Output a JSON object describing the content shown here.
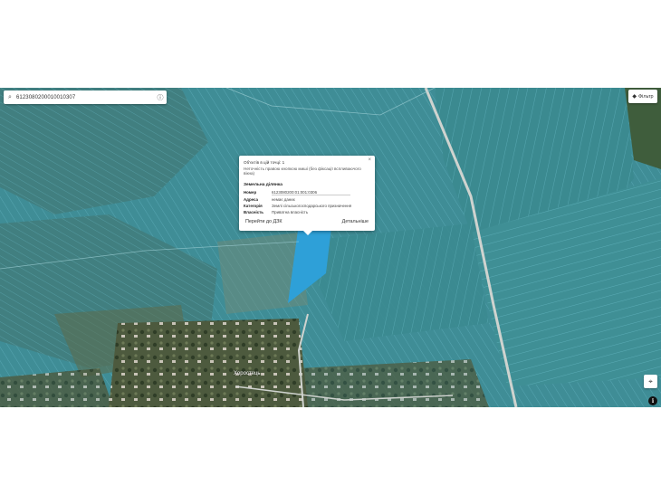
{
  "search": {
    "value": "6123080200010010307",
    "icon": "search-icon",
    "info_icon": "info-circle-icon"
  },
  "filter": {
    "label": "Фільтр",
    "icon": "layers-icon"
  },
  "popup": {
    "close_symbol": "×",
    "objects_line": "Об'єктів в цій точці: 1",
    "disclaimer": "Неточність правою кнопкою миші (без фіксації вспливаючого вікна)",
    "section_title": "Земельна ділянка",
    "rows": [
      {
        "key": "Номер",
        "value": "6123080200:01:001:0306"
      },
      {
        "key": "Адреса",
        "value": "немає даних"
      },
      {
        "key": "Категорія",
        "value": "Землі сільськогосподарського призначення"
      },
      {
        "key": "Власність",
        "value": "Приватна власність"
      }
    ],
    "link_dzk": "Перейти до ДЗК",
    "link_details": "Детальніше"
  },
  "map": {
    "village_label": "Хоростець",
    "locate_icon": "crosshair-icon",
    "info_icon": "info-icon"
  },
  "colors": {
    "parcel_overlay": "#3aa3b8",
    "highlighted_parcel": "#2ea0d8",
    "road": "#cfd3cf"
  }
}
